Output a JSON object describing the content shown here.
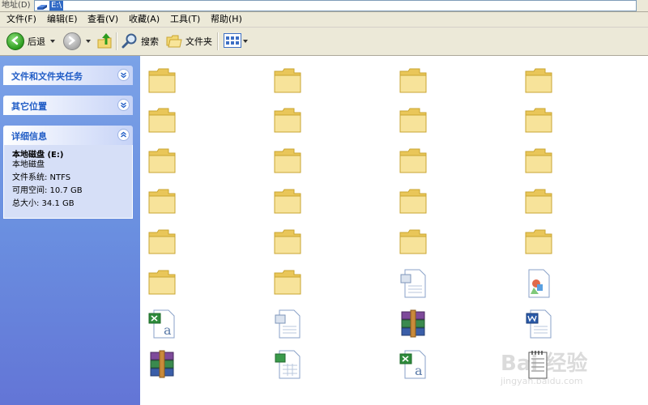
{
  "address_bar": {
    "label": "地址(D)",
    "path": "E:\\"
  },
  "menu": {
    "items": [
      "文件(F)",
      "编辑(E)",
      "查看(V)",
      "收藏(A)",
      "工具(T)",
      "帮助(H)"
    ]
  },
  "toolbar": {
    "back_label": "后退",
    "search_label": "搜索",
    "folders_label": "文件夹"
  },
  "task_pane": {
    "panels": [
      {
        "title": "文件和文件夹任务",
        "state": "collapsed"
      },
      {
        "title": "其它位置",
        "state": "collapsed"
      },
      {
        "title": "详细信息",
        "state": "expanded"
      }
    ],
    "details": {
      "name": "本地磁盘 (E:)",
      "type": "本地磁盘",
      "filesystem": "文件系统: NTFS",
      "free": "可用空间: 10.7 GB",
      "total": "总大小: 34.1 GB"
    }
  },
  "files": [
    {
      "icon": "folder-icon"
    },
    {
      "icon": "folder-icon"
    },
    {
      "icon": "folder-icon"
    },
    {
      "icon": "folder-icon"
    },
    {
      "icon": "folder-icon"
    },
    {
      "icon": "folder-icon"
    },
    {
      "icon": "folder-icon"
    },
    {
      "icon": "folder-icon"
    },
    {
      "icon": "folder-icon"
    },
    {
      "icon": "folder-icon"
    },
    {
      "icon": "folder-icon"
    },
    {
      "icon": "folder-icon"
    },
    {
      "icon": "folder-icon"
    },
    {
      "icon": "folder-icon"
    },
    {
      "icon": "folder-icon"
    },
    {
      "icon": "folder-icon"
    },
    {
      "icon": "folder-icon"
    },
    {
      "icon": "folder-icon"
    },
    {
      "icon": "folder-icon"
    },
    {
      "icon": "folder-icon"
    },
    {
      "icon": "folder-icon"
    },
    {
      "icon": "folder-icon"
    },
    {
      "icon": "document-icon"
    },
    {
      "icon": "picture-document-icon"
    },
    {
      "icon": "excel-file-icon"
    },
    {
      "icon": "document-icon"
    },
    {
      "icon": "winrar-archive-icon"
    },
    {
      "icon": "word-document-icon"
    },
    {
      "icon": "winrar-archive-icon"
    },
    {
      "icon": "spreadsheet-document-icon"
    },
    {
      "icon": "excel-file-icon"
    },
    {
      "icon": "notepad-document-icon"
    }
  ],
  "watermark": {
    "main": "Bai 经验",
    "sub": "jingyan.baidu.com"
  },
  "colors": {
    "task_pane_blue": "#6a8fe0",
    "panel_title": "#215dc6",
    "folder_yellow": "#f2d873"
  }
}
